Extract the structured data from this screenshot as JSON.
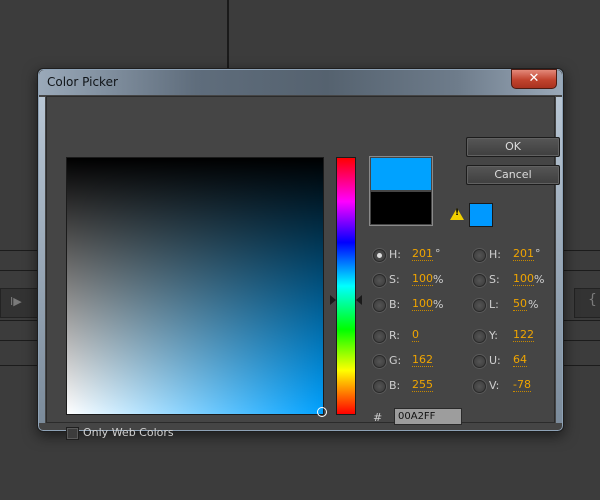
{
  "window": {
    "title": "Color Picker",
    "close_glyph": "✕"
  },
  "buttons": {
    "ok": "OK",
    "cancel": "Cancel"
  },
  "colors": {
    "new_color": "#00A2FF",
    "old_color": "#000000",
    "websafe_color": "#0099FF",
    "value_text": "#F0A500"
  },
  "hsb": {
    "h": {
      "label": "H:",
      "value": "201",
      "unit": "°",
      "selected": true
    },
    "s": {
      "label": "S:",
      "value": "100",
      "unit": "%"
    },
    "b": {
      "label": "B:",
      "value": "100",
      "unit": "%"
    }
  },
  "hsl": {
    "h": {
      "label": "H:",
      "value": "201",
      "unit": "°"
    },
    "s": {
      "label": "S:",
      "value": "100",
      "unit": "%"
    },
    "l": {
      "label": "L:",
      "value": "50",
      "unit": "%"
    }
  },
  "rgb": {
    "r": {
      "label": "R:",
      "value": "0"
    },
    "g": {
      "label": "G:",
      "value": "162"
    },
    "b": {
      "label": "B:",
      "value": "255"
    }
  },
  "yuv": {
    "y": {
      "label": "Y:",
      "value": "122"
    },
    "u": {
      "label": "U:",
      "value": "64"
    },
    "v": {
      "label": "V:",
      "value": "-78"
    }
  },
  "hex": {
    "label": "#",
    "value": "00A2FF"
  },
  "web_colors": {
    "label": "Only Web Colors",
    "checked": false
  },
  "icons": [
    "close-icon",
    "warning-icon",
    "play-icon"
  ]
}
